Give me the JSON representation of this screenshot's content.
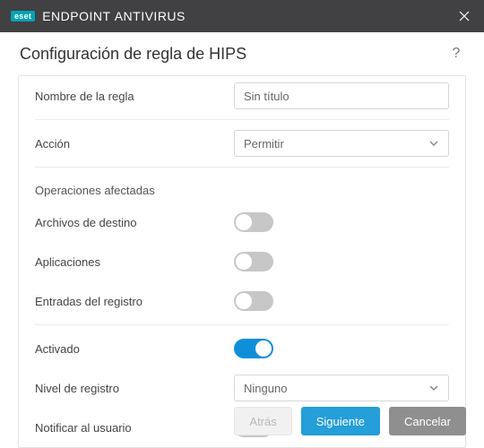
{
  "titlebar": {
    "badge": "eset",
    "product_thin": "ENDPOINT ",
    "product_bold": "ANTIVIRUS"
  },
  "header": {
    "title": "Configuración de regla de HIPS",
    "help": "?"
  },
  "form": {
    "rule_name_label": "Nombre de la regla",
    "rule_name_value": "Sin título",
    "action_label": "Acción",
    "action_value": "Permitir",
    "affected_section": "Operaciones afectadas",
    "target_files_label": "Archivos de destino",
    "target_files_on": false,
    "apps_label": "Aplicaciones",
    "apps_on": false,
    "registry_label": "Entradas del registro",
    "registry_on": false,
    "enabled_label": "Activado",
    "enabled_on": true,
    "log_level_label": "Nivel de registro",
    "log_level_value": "Ninguno",
    "notify_label": "Notificar al usuario",
    "notify_on": false
  },
  "footer": {
    "back": "Atrás",
    "next": "Siguiente",
    "cancel": "Cancelar"
  }
}
